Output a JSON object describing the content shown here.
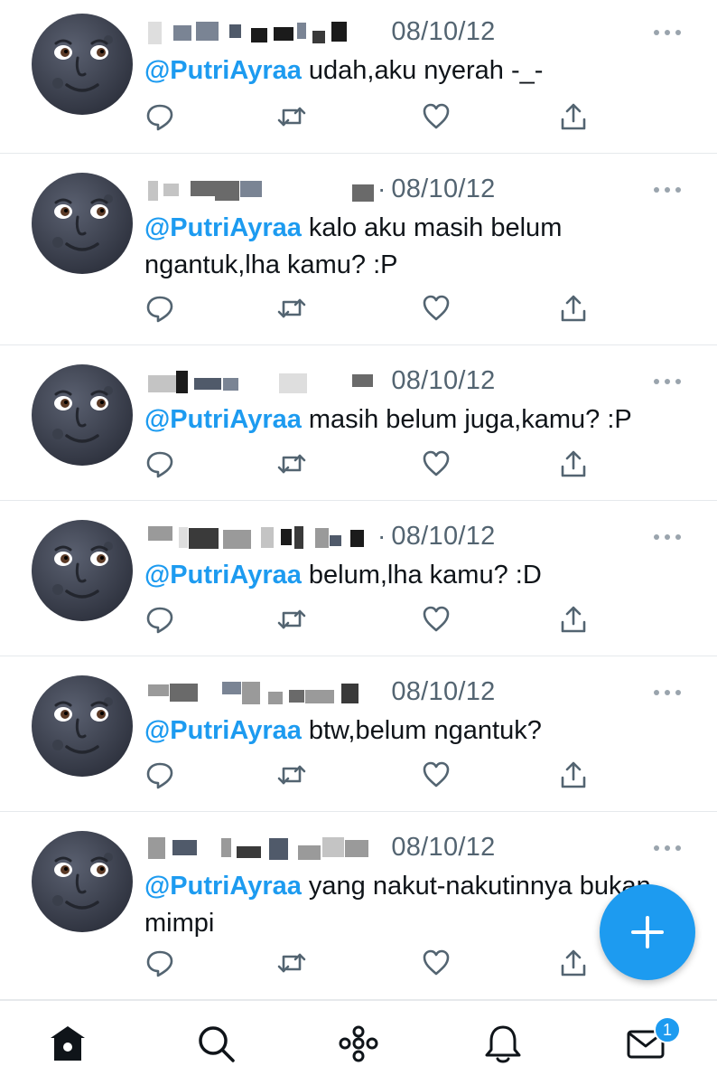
{
  "tweets": [
    {
      "date": "08/10/12",
      "mention": "@PutriAyraa",
      "text": "udah,aku nyerah -_-",
      "show_dot": false
    },
    {
      "date": "08/10/12",
      "mention": "@PutriAyraa",
      "text": "kalo aku masih belum ngantuk,lha kamu? :P",
      "show_dot": true
    },
    {
      "date": "08/10/12",
      "mention": "@PutriAyraa",
      "text": "masih belum juga,kamu? :P",
      "show_dot": false
    },
    {
      "date": "08/10/12",
      "mention": "@PutriAyraa",
      "text": "belum,lha kamu? :D",
      "show_dot": true
    },
    {
      "date": "08/10/12",
      "mention": "@PutriAyraa",
      "text": "btw,belum ngantuk?",
      "show_dot": false
    },
    {
      "date": "08/10/12",
      "mention": "@PutriAyraa",
      "text": "yang nakut-nakutinnya bukan mimpi",
      "show_dot": false
    }
  ],
  "separator_dot": "·",
  "nav": {
    "tabs": [
      "home-icon",
      "search-icon",
      "spaces-icon",
      "notifications-icon",
      "messages-icon"
    ],
    "messages_badge": "1"
  },
  "colors": {
    "accent": "#1d9bf0",
    "text_secondary": "#536471",
    "icon": "#536471"
  }
}
